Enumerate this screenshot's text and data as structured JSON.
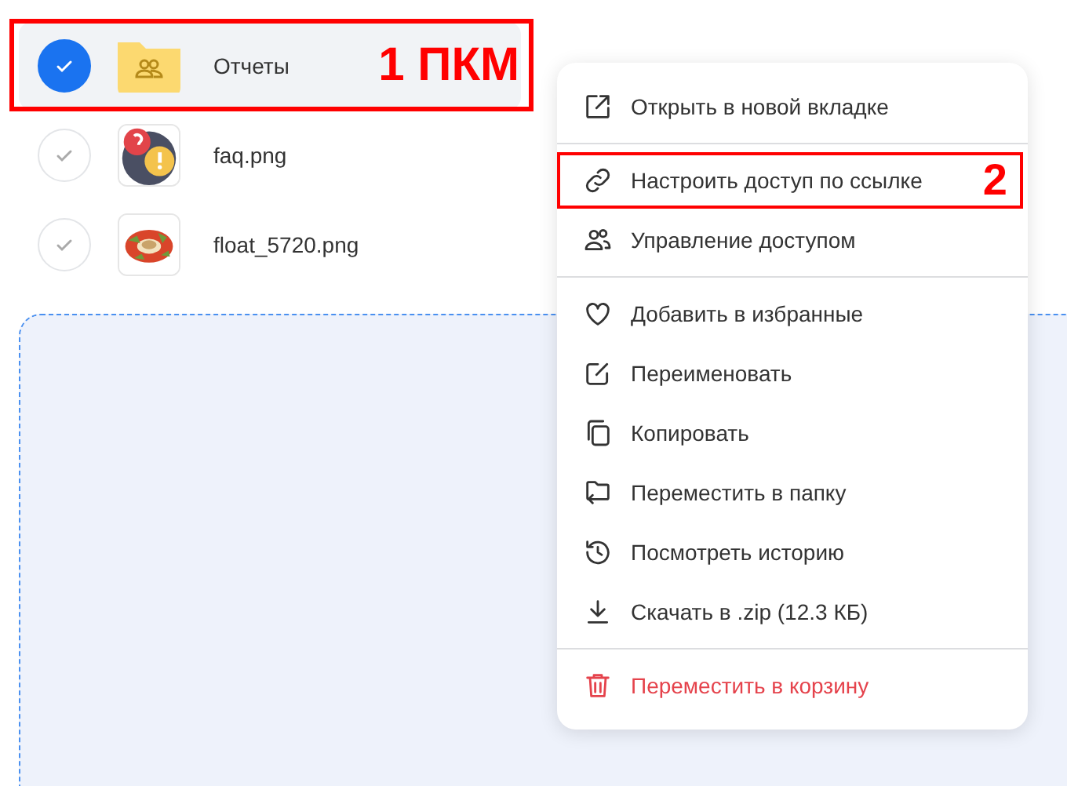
{
  "files": [
    {
      "name": "Отчеты",
      "kind": "folder",
      "selected": true,
      "callout": "1 ПКМ"
    },
    {
      "name": "faq.png",
      "selected": false
    },
    {
      "name": "float_5720.png",
      "selected": false
    }
  ],
  "context_menu": {
    "groups": [
      [
        {
          "label": "Открыть в новой вкладке",
          "kind": "normal"
        }
      ],
      [
        {
          "label": "Настроить доступ по ссылке",
          "kind": "normal",
          "callout": "2"
        },
        {
          "label": "Управление доступом",
          "kind": "normal"
        }
      ],
      [
        {
          "label": "Добавить в избранные",
          "kind": "normal"
        },
        {
          "label": "Переименовать",
          "kind": "normal"
        },
        {
          "label": "Копировать",
          "kind": "normal"
        },
        {
          "label": "Переместить в папку",
          "kind": "normal"
        },
        {
          "label": "Посмотреть историю",
          "kind": "normal"
        },
        {
          "label": "Скачать в .zip (12.3 КБ)",
          "kind": "normal"
        }
      ],
      [
        {
          "label": "Переместить в корзину",
          "kind": "danger"
        }
      ]
    ]
  }
}
